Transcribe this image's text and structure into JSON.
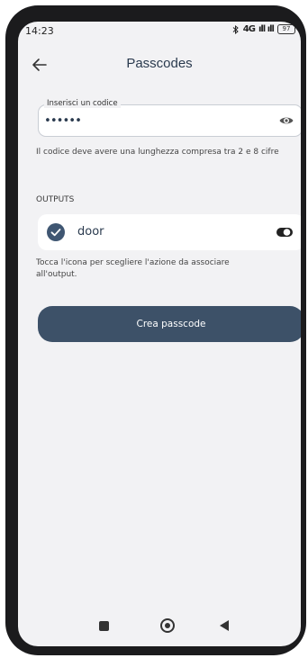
{
  "status_bar": {
    "time": "14:23",
    "bluetooth_icon": "bluetooth-icon",
    "signal_label": "4G",
    "battery": "97"
  },
  "header": {
    "title": "Passcodes",
    "back_icon": "arrow-left-icon"
  },
  "code_field": {
    "label": "Inserisci un codice",
    "value": "••••••",
    "eye_icon": "eye-icon"
  },
  "hint": "Il codice deve avere una lunghezza compresa tra 2 e 8 cifre",
  "outputs": {
    "section_label": "OUTPUTS",
    "items": [
      {
        "name": "door",
        "checked": true,
        "icon": "check-circle-icon",
        "toggle_icon": "toggle-icon"
      }
    ],
    "hint": "Tocca l'icona per scegliere l'azione da associare all'output."
  },
  "primary_button": {
    "label": "Crea passcode"
  },
  "colors": {
    "accent": "#3d5168",
    "background": "#f2f2f4",
    "title": "#2a3a4e"
  }
}
